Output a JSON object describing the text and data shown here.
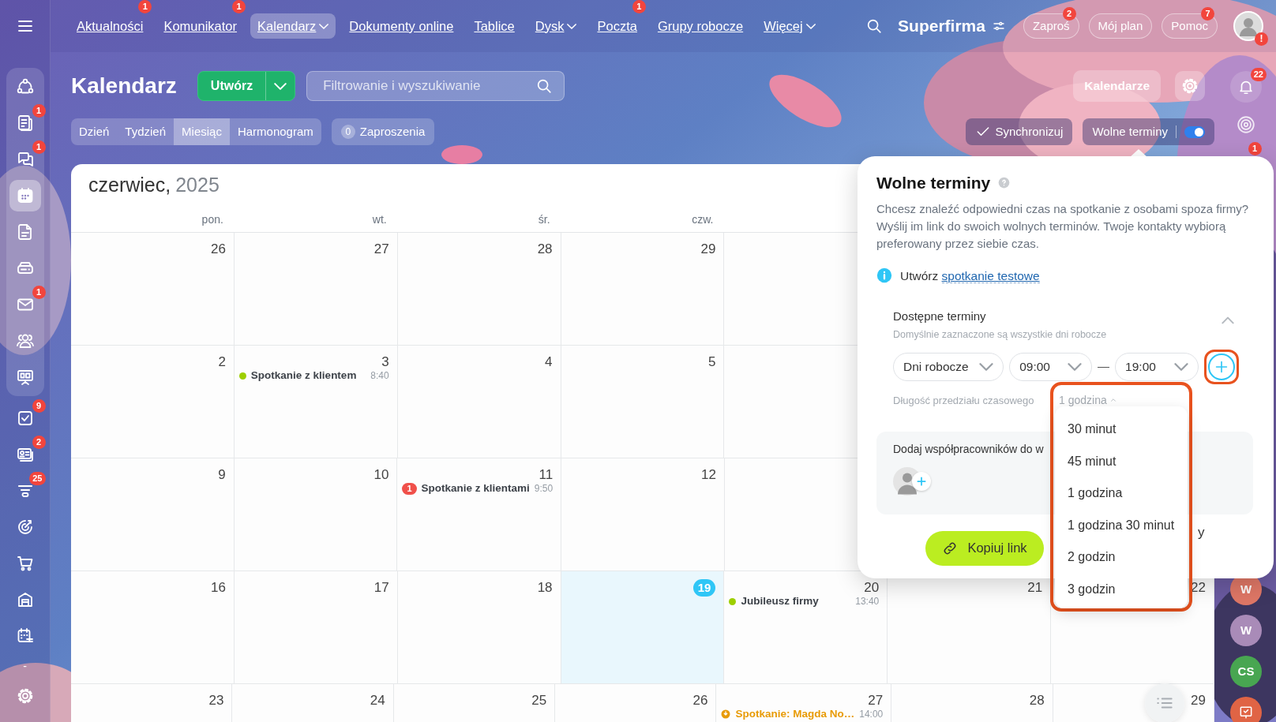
{
  "sidebar": {
    "items": [
      {
        "kind": "nodes",
        "selected": false
      },
      {
        "kind": "news",
        "badge": "1",
        "selected": false
      },
      {
        "kind": "chat",
        "badge": "1",
        "selected": false
      },
      {
        "kind": "calendar",
        "selected": true
      },
      {
        "kind": "document",
        "selected": false
      },
      {
        "kind": "drive",
        "selected": false
      },
      {
        "kind": "mail",
        "badge": "1",
        "selected": false
      },
      {
        "kind": "people",
        "selected": false
      },
      {
        "kind": "board",
        "selected": false
      },
      {
        "kind": "tasks",
        "badge": "9",
        "selected": false
      },
      {
        "kind": "card",
        "badge": "2",
        "selected": false
      },
      {
        "kind": "funnel",
        "badge": "25",
        "selected": false
      },
      {
        "kind": "target",
        "selected": false
      },
      {
        "kind": "cart",
        "selected": false
      },
      {
        "kind": "warehouse",
        "selected": false
      },
      {
        "kind": "schedule",
        "selected": false
      },
      {
        "kind": "text",
        "label": "-",
        "selected": false
      },
      {
        "kind": "settings",
        "selected": false
      }
    ]
  },
  "top_nav": {
    "items": [
      {
        "label": "Aktualności",
        "badge": "1",
        "selected": false,
        "dropdown": false
      },
      {
        "label": "Komunikator",
        "badge": "1",
        "selected": false,
        "dropdown": false
      },
      {
        "label": "Kalendarz",
        "selected": true,
        "dropdown": true
      },
      {
        "label": "Dokumenty online",
        "selected": false,
        "dropdown": false
      },
      {
        "label": "Tablice",
        "selected": false,
        "dropdown": false
      },
      {
        "label": "Dysk",
        "selected": false,
        "dropdown": true
      },
      {
        "label": "Poczta",
        "badge": "1",
        "selected": false,
        "dropdown": false
      },
      {
        "label": "Grupy robocze",
        "selected": false,
        "dropdown": false
      },
      {
        "label": "Więcej",
        "selected": false,
        "dropdown": true
      }
    ],
    "company": "Superfirma",
    "buttons": [
      {
        "label": "Zaproś",
        "badge": "2"
      },
      {
        "label": "Mój plan"
      },
      {
        "label": "Pomoc",
        "badge": "7"
      }
    ],
    "profile_alert": "!"
  },
  "header": {
    "title": "Kalendarz",
    "create_button": "Utwórz",
    "search": {
      "placeholder": "Filtrowanie i wyszukiwanie"
    },
    "calendars_button": "Kalendarze"
  },
  "view_tabs": [
    {
      "label": "Dzień",
      "selected": false
    },
    {
      "label": "Tydzień",
      "selected": false
    },
    {
      "label": "Miesiąc",
      "selected": true
    },
    {
      "label": "Harmonogram",
      "selected": false
    }
  ],
  "invitations": {
    "count": "0",
    "label": "Zaproszenia"
  },
  "sync_button": "Synchronizuj",
  "free_slots_toggle": {
    "label": "Wolne terminy",
    "on": true
  },
  "right_rail": {
    "notifications_badge": "22",
    "hidden_badge": "1",
    "items": [
      {
        "kind": "initials",
        "label": "W",
        "color": "#df7766"
      },
      {
        "kind": "initials",
        "label": "W",
        "color": "#a98bb8"
      },
      {
        "kind": "initials",
        "label": "CS",
        "color": "#48a651"
      },
      {
        "kind": "task",
        "color": "#e06445"
      }
    ]
  },
  "calendar": {
    "month": "czerwiec,",
    "year": "2025",
    "weekdays": [
      "pon.",
      "wt.",
      "śr.",
      "czw."
    ],
    "weeks": [
      [
        {
          "day": "26",
          "today": false
        },
        {
          "day": "27",
          "today": false
        },
        {
          "day": "28",
          "today": false
        },
        {
          "day": "29",
          "today": false
        }
      ],
      [
        {
          "day": "2",
          "today": false
        },
        {
          "day": "3",
          "today": false,
          "events": [
            {
              "kind": "dot",
              "title": "Spotkanie z klientem",
              "time": "8:40",
              "color": "#9dcf00"
            }
          ]
        },
        {
          "day": "4",
          "today": false
        },
        {
          "day": "5",
          "today": false
        }
      ],
      [
        {
          "day": "9",
          "today": false
        },
        {
          "day": "10",
          "today": false
        },
        {
          "day": "11",
          "today": false,
          "events": [
            {
              "kind": "count",
              "count": "1",
              "title": "Spotkanie z klientami",
              "time": "9:50",
              "color": "#f0504a"
            }
          ]
        },
        {
          "day": "12",
          "today": false
        }
      ],
      [
        {
          "day": "16",
          "today": false
        },
        {
          "day": "17",
          "today": false
        },
        {
          "day": "18",
          "today": false
        },
        {
          "day": "19",
          "today": true
        },
        {
          "day": "20",
          "today": false,
          "events": [
            {
              "kind": "dot",
              "title": "Jubileusz firmy",
              "time": "13:40",
              "color": "#9dcf00"
            }
          ]
        },
        {
          "day": "21",
          "today": false
        },
        {
          "day": "22",
          "today": false
        }
      ],
      [
        {
          "day": "23",
          "today": false
        },
        {
          "day": "24",
          "today": false
        },
        {
          "day": "25",
          "today": false
        },
        {
          "day": "26",
          "today": false
        },
        {
          "day": "27",
          "today": false,
          "events": [
            {
              "kind": "alert",
              "title": "Spotkanie: Magda No…",
              "time": "14:00",
              "color": "#e89b06"
            }
          ]
        },
        {
          "day": "28",
          "today": false
        },
        {
          "day": "29",
          "today": false
        }
      ]
    ]
  },
  "free_slots_popover": {
    "title": "Wolne terminy",
    "description": "Chcesz znaleźć odpowiedni czas na spotkanie z osobami spoza firmy? Wyślij im link do swoich wolnych terminów. Twoje kontakty wybiorą preferowany przez siebie czas.",
    "info_text": "Utwórz",
    "info_link": "spotkanie testowe",
    "section_title": "Dostępne terminy",
    "section_hint": "Domyślnie zaznaczone są wszystkie dni robocze",
    "expanded": true,
    "day_select": "Dni robocze",
    "from_time": "09:00",
    "separator": "—",
    "to_time": "19:00",
    "duration_label": "Długość przedziału czasowego",
    "duration_value": "1 godzina",
    "collaborators_label": "Dodaj współpracowników do w",
    "copy_button": "Kopiuj link",
    "trailing_text": "y"
  },
  "duration_dropdown": {
    "options": [
      {
        "label": "30 minut",
        "selected": false
      },
      {
        "label": "45 minut",
        "selected": false
      },
      {
        "label": "1 godzina",
        "selected": false
      },
      {
        "label": "1 godzina 30 minut",
        "selected": false
      },
      {
        "label": "2 godzin",
        "selected": false
      },
      {
        "label": "3 godzin",
        "selected": false
      }
    ]
  }
}
